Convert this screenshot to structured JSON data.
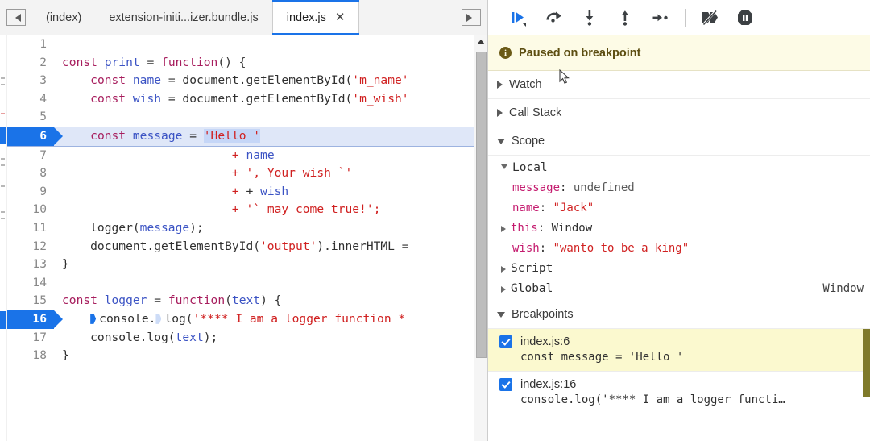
{
  "window": {
    "title": "Chrome DevTools Sources - Debugger paused"
  },
  "tabbar": {
    "scroll_left_icon": "scroll-tabs-left-icon",
    "scroll_right_icon": "scroll-tabs-right-icon",
    "tabs": [
      {
        "label": "(index)",
        "active": false,
        "closable": false
      },
      {
        "label": "extension-initi...izer.bundle.js",
        "active": false,
        "closable": false
      },
      {
        "label": "index.js",
        "active": true,
        "closable": true,
        "close_glyph": "✕"
      }
    ]
  },
  "editor": {
    "file": "index.js",
    "paused_line": 6,
    "breakpoint_lines": [
      6,
      16
    ],
    "lines": [
      {
        "n": "1",
        "tokens": []
      },
      {
        "n": "2",
        "tokens": [
          {
            "t": "const",
            "c": "kw"
          },
          {
            "t": " ",
            "c": "plain"
          },
          {
            "t": "print",
            "c": "var"
          },
          {
            "t": " = ",
            "c": "op"
          },
          {
            "t": "function",
            "c": "kw"
          },
          {
            "t": "() {",
            "c": "plain"
          }
        ]
      },
      {
        "n": "3",
        "tokens": [
          {
            "t": "    ",
            "c": "plain"
          },
          {
            "t": "const",
            "c": "kw"
          },
          {
            "t": " ",
            "c": "plain"
          },
          {
            "t": "name",
            "c": "var"
          },
          {
            "t": " = document.getElementById(",
            "c": "plain"
          },
          {
            "t": "'m_name'",
            "c": "str"
          }
        ]
      },
      {
        "n": "4",
        "tokens": [
          {
            "t": "    ",
            "c": "plain"
          },
          {
            "t": "const",
            "c": "kw"
          },
          {
            "t": " ",
            "c": "plain"
          },
          {
            "t": "wish",
            "c": "var"
          },
          {
            "t": " = document.getElementById(",
            "c": "plain"
          },
          {
            "t": "'m_wish'",
            "c": "str"
          }
        ]
      },
      {
        "n": "5",
        "tokens": []
      },
      {
        "n": "6",
        "tokens": [
          {
            "t": "    ",
            "c": "plain"
          },
          {
            "t": "const",
            "c": "kw"
          },
          {
            "t": " ",
            "c": "plain"
          },
          {
            "t": "message",
            "c": "var"
          },
          {
            "t": " = ",
            "c": "op"
          },
          {
            "t": "'Hello '",
            "c": "str sel"
          }
        ]
      },
      {
        "n": "7",
        "tokens": [
          {
            "t": "                        ",
            "c": "plain"
          },
          {
            "t": "+",
            "c": "str"
          },
          {
            "t": " ",
            "c": "plain"
          },
          {
            "t": "name",
            "c": "var"
          }
        ]
      },
      {
        "n": "8",
        "tokens": [
          {
            "t": "                        ",
            "c": "plain"
          },
          {
            "t": "+",
            "c": "str"
          },
          {
            "t": " ",
            "c": "plain"
          },
          {
            "t": "', Your wish `'",
            "c": "str"
          }
        ]
      },
      {
        "n": "9",
        "tokens": [
          {
            "t": "                        ",
            "c": "plain"
          },
          {
            "t": "+",
            "c": "str"
          },
          {
            "t": " + ",
            "c": "plain"
          },
          {
            "t": "wish",
            "c": "var"
          }
        ]
      },
      {
        "n": "10",
        "tokens": [
          {
            "t": "                        ",
            "c": "plain"
          },
          {
            "t": "+",
            "c": "str"
          },
          {
            "t": " ",
            "c": "plain"
          },
          {
            "t": "'` may come true!';",
            "c": "str"
          }
        ]
      },
      {
        "n": "11",
        "tokens": [
          {
            "t": "    logger(",
            "c": "plain"
          },
          {
            "t": "message",
            "c": "var"
          },
          {
            "t": ");",
            "c": "plain"
          }
        ]
      },
      {
        "n": "12",
        "tokens": [
          {
            "t": "    document.getElementById(",
            "c": "plain"
          },
          {
            "t": "'output'",
            "c": "str"
          },
          {
            "t": ").innerHTML =",
            "c": "plain"
          }
        ]
      },
      {
        "n": "13",
        "tokens": [
          {
            "t": "}",
            "c": "plain"
          }
        ]
      },
      {
        "n": "14",
        "tokens": []
      },
      {
        "n": "15",
        "tokens": [
          {
            "t": "const",
            "c": "kw"
          },
          {
            "t": " ",
            "c": "plain"
          },
          {
            "t": "logger",
            "c": "var"
          },
          {
            "t": " = ",
            "c": "op"
          },
          {
            "t": "function",
            "c": "kw"
          },
          {
            "t": "(",
            "c": "plain"
          },
          {
            "t": "text",
            "c": "var"
          },
          {
            "t": ") {",
            "c": "plain"
          }
        ]
      },
      {
        "n": "16",
        "tokens": [
          {
            "t": "    ",
            "c": "plain"
          },
          {
            "t": "▶",
            "c": "chev-solid"
          },
          {
            "t": "console.",
            "c": "plain"
          },
          {
            "t": "▷",
            "c": "chev-hollow"
          },
          {
            "t": "log(",
            "c": "plain"
          },
          {
            "t": "'**** I am a logger function *",
            "c": "str"
          }
        ]
      },
      {
        "n": "17",
        "tokens": [
          {
            "t": "    console.log(",
            "c": "plain"
          },
          {
            "t": "text",
            "c": "var"
          },
          {
            "t": ");",
            "c": "plain"
          }
        ]
      },
      {
        "n": "18",
        "tokens": [
          {
            "t": "}",
            "c": "plain"
          }
        ]
      }
    ]
  },
  "debugger": {
    "toolbar": [
      {
        "name": "resume-button",
        "tooltip": "Resume script execution"
      },
      {
        "name": "step-over-button",
        "tooltip": "Step over next function call"
      },
      {
        "name": "step-into-button",
        "tooltip": "Step into next function call"
      },
      {
        "name": "step-out-button",
        "tooltip": "Step out of current function"
      },
      {
        "name": "step-button",
        "tooltip": "Step"
      },
      {
        "name": "deactivate-breakpoints-button",
        "tooltip": "Deactivate breakpoints"
      },
      {
        "name": "pause-on-exceptions-button",
        "tooltip": "Pause on exceptions"
      }
    ],
    "paused_banner": {
      "icon": "info-icon",
      "text": "Paused on breakpoint"
    },
    "sections": [
      {
        "name": "watch",
        "label": "Watch",
        "expanded": false
      },
      {
        "name": "call-stack",
        "label": "Call Stack",
        "expanded": false
      },
      {
        "name": "scope",
        "label": "Scope",
        "expanded": true
      }
    ],
    "scope": {
      "groups": [
        {
          "label": "Local",
          "expanded": true
        },
        {
          "label": "Script",
          "expanded": false
        },
        {
          "label": "Global",
          "expanded": false,
          "value": "Window"
        }
      ],
      "local_vars": [
        {
          "name": "message",
          "sep": ": ",
          "value": "undefined",
          "value_kind": "undefined",
          "expandable": false
        },
        {
          "name": "name",
          "sep": ": ",
          "value": "\"Jack\"",
          "value_kind": "string",
          "expandable": false
        },
        {
          "name": "this",
          "sep": ": ",
          "value": "Window",
          "value_kind": "object",
          "expandable": true
        },
        {
          "name": "wish",
          "sep": ": ",
          "value": "\"wanto to be a king\"",
          "value_kind": "string",
          "expandable": false
        }
      ]
    },
    "breakpoints": {
      "label": "Breakpoints",
      "expanded": true,
      "items": [
        {
          "checked": true,
          "location": "index.js:6",
          "snippet": "const message = 'Hello '",
          "active": true
        },
        {
          "checked": true,
          "location": "index.js:16",
          "snippet": "console.log('**** I am a logger functi…",
          "active": false
        }
      ]
    }
  },
  "colors": {
    "accent_blue": "#1a73e8",
    "paused_banner_bg": "#fdfbe6",
    "paused_line_bg": "#dfe7f8",
    "breakpoint_highlight_bg": "#fbf9cf",
    "keyword": "#a71d5d",
    "string": "#d02020",
    "variable": "#3b53c4",
    "property": "#c41a6e"
  }
}
